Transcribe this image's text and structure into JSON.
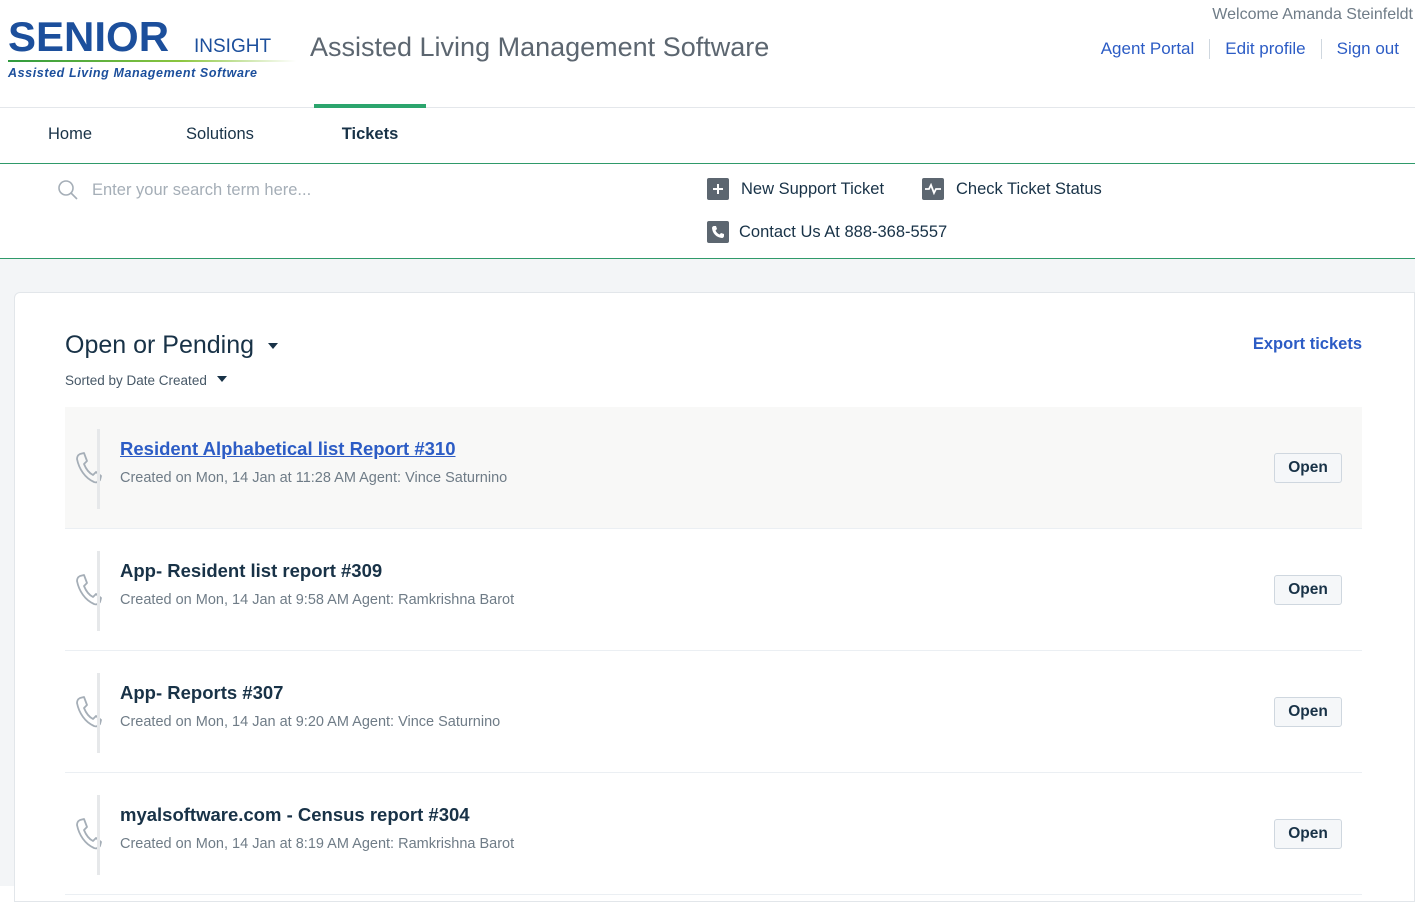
{
  "header": {
    "logo_main": "SENIOR",
    "logo_insight": "INSIGHT",
    "logo_tagline": "Assisted Living Management Software",
    "app_title": "Assisted Living Management Software",
    "welcome": "Welcome Amanda Steinfeldt",
    "links": [
      "Agent Portal",
      "Edit profile",
      "Sign out"
    ]
  },
  "nav": {
    "items": [
      "Home",
      "Solutions",
      "Tickets"
    ],
    "active": "Tickets"
  },
  "search": {
    "placeholder": "Enter your search term here...",
    "value": ""
  },
  "actions": {
    "new_ticket": "New Support Ticket",
    "check_status": "Check Ticket Status",
    "contact": "Contact Us At 888-368-5557"
  },
  "tickets_view": {
    "filter_label": "Open or Pending",
    "sort_label": "Sorted by Date Created",
    "export_label": "Export tickets",
    "tickets": [
      {
        "title": "Resident Alphabetical list Report #310",
        "meta": "Created on Mon, 14 Jan at 11:28 AM Agent: Vince Saturnino",
        "status": "Open"
      },
      {
        "title": "App- Resident list report #309",
        "meta": "Created on Mon, 14 Jan at 9:58 AM Agent: Ramkrishna Barot",
        "status": "Open"
      },
      {
        "title": "App- Reports #307",
        "meta": "Created on Mon, 14 Jan at 9:20 AM Agent: Vince Saturnino",
        "status": "Open"
      },
      {
        "title": "myalsoftware.com - Census report #304",
        "meta": "Created on Mon, 14 Jan at 8:19 AM Agent: Ramkrishna Barot",
        "status": "Open"
      }
    ]
  },
  "colors": {
    "brand_blue": "#1c4f9c",
    "link_blue": "#2c5cc5",
    "accent_green": "#2ba56d"
  }
}
